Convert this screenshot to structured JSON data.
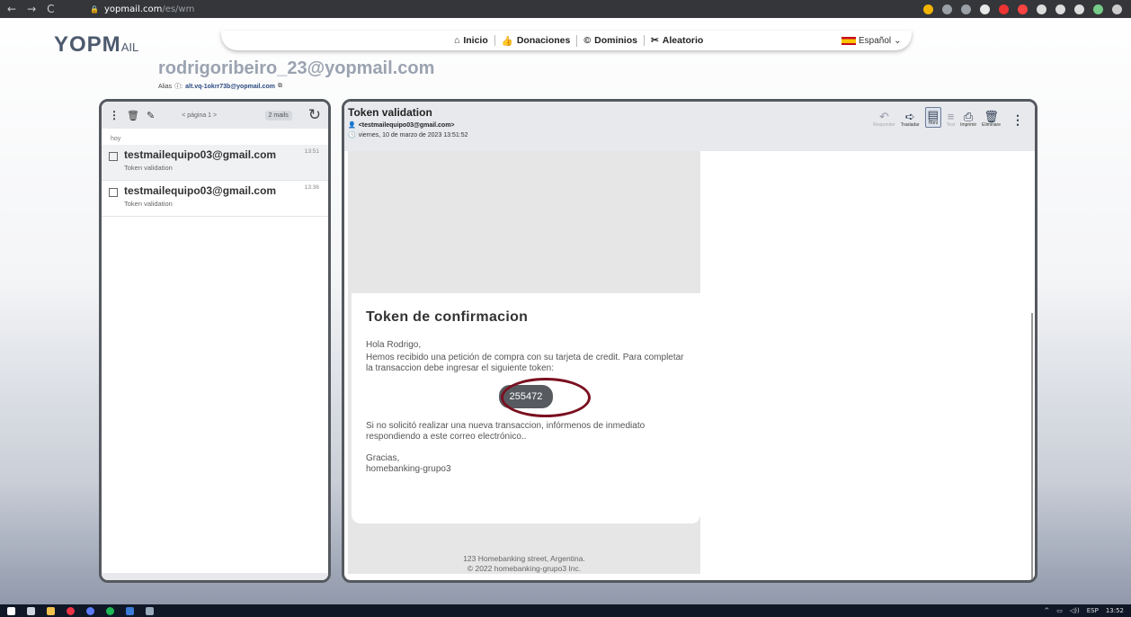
{
  "browser": {
    "url_domain": "yopmail.com",
    "url_path": "/es/wm",
    "nav_back": "←",
    "nav_forward": "→",
    "nav_reload": "C",
    "lock": "🔒"
  },
  "topnav": {
    "links": [
      {
        "icon": "⌂",
        "label": "Inicio"
      },
      {
        "icon": "👍",
        "label": "Donaciones"
      },
      {
        "icon": "©",
        "label": "Dominios"
      },
      {
        "icon": "✂",
        "label": "Aleatorio"
      }
    ],
    "language": "Español",
    "language_caret": "⌄"
  },
  "logo": {
    "main": "YOPM",
    "suffix": "AIL"
  },
  "account": {
    "email": "rodrigoribeiro_23@yopmail.com",
    "alias_label": "Alias",
    "alias_value": "alt.vq-1okrr73b@yopmail.com"
  },
  "inbox": {
    "page_label": "< página 1 >",
    "count_label": "2 mails",
    "day_label": "hoy",
    "items": [
      {
        "from": "testmailequipo03@gmail.com",
        "subject": "Token validation",
        "time": "13:51"
      },
      {
        "from": "testmailequipo03@gmail.com",
        "subject": "Token validation",
        "time": "13:36"
      }
    ]
  },
  "message": {
    "title": "Token validation",
    "from": "<testmailequipo03@gmail.com>",
    "date": "viernes, 10 de marzo de 2023 13:51:52",
    "actions": [
      {
        "icon": "↶",
        "label": "Responder",
        "state": "dim"
      },
      {
        "icon": "➪",
        "label": "Trasladar",
        "state": "normal"
      },
      {
        "icon": "▤",
        "label": "Html",
        "state": "selected"
      },
      {
        "icon": "≡",
        "label": "Text",
        "state": "dim"
      },
      {
        "icon": "⎙",
        "label": "Imprimir",
        "state": "normal"
      },
      {
        "icon": "🗑",
        "label": "Eliminare",
        "state": "normal"
      }
    ],
    "body": {
      "heading": "Token de confirmacion",
      "greeting": "Hola Rodrigo,",
      "paragraph1": "Hemos recibido una petición de compra con su tarjeta de credit. Para completar la transaccion debe ingresar el siguiente token:",
      "token": "255472",
      "paragraph2": "Si no solicitó realizar una nueva transaccion, infórmenos de inmediato respondiendo a este correo electrónico..",
      "thanks": "Gracias,",
      "signature": "homebanking-grupo3",
      "footer_address": "123 Homebanking street, Argentina.",
      "footer_copyright": "© 2022 homebanking-grupo3 Inc."
    }
  },
  "taskbar": {
    "tray_lang": "ESP",
    "tray_time": "13:52"
  },
  "colors": {
    "token_ring": "#7a1020",
    "panel_border": "#55595f"
  }
}
